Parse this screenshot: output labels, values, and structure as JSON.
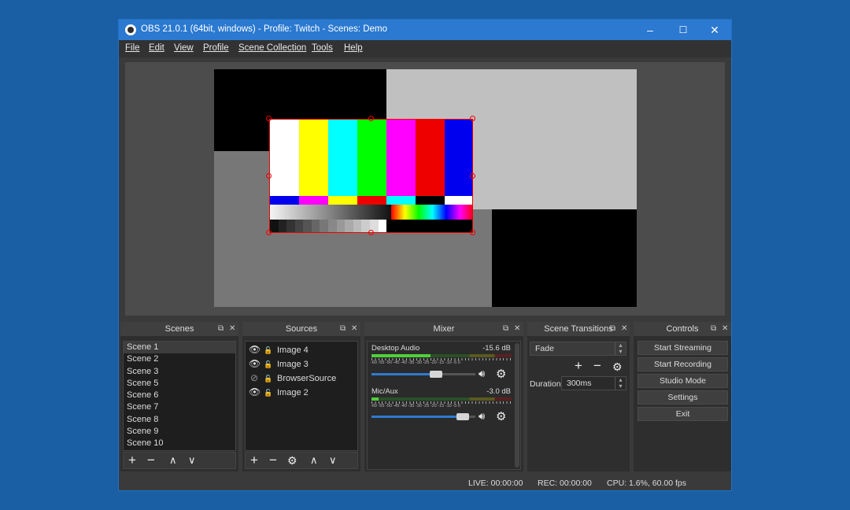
{
  "window": {
    "title": "OBS 21.0.1 (64bit, windows) - Profile: Twitch - Scenes: Demo",
    "controls": {
      "minimize": "–",
      "maximize": "☐",
      "close": "✕"
    }
  },
  "menu": [
    "File",
    "Edit",
    "View",
    "Profile",
    "Scene Collection",
    "Tools",
    "Help"
  ],
  "docks": {
    "scenes": {
      "title": "Scenes",
      "items": [
        "Scene 1",
        "Scene 2",
        "Scene 3",
        "Scene 5",
        "Scene 6",
        "Scene 7",
        "Scene 8",
        "Scene 9",
        "Scene 10"
      ],
      "selected": "Scene 1"
    },
    "sources": {
      "title": "Sources",
      "items": [
        {
          "name": "Image 4",
          "icon": "eye-icon"
        },
        {
          "name": "Image 3",
          "icon": "eye-icon"
        },
        {
          "name": "BrowserSource",
          "icon": "eye-hidden-icon"
        },
        {
          "name": "Image 2",
          "icon": "eye-icon"
        }
      ]
    },
    "mixer": {
      "title": "Mixer",
      "channels": [
        {
          "name": "Desktop Audio",
          "db": "-15.6 dB",
          "level": 0.42,
          "volume": 0.62
        },
        {
          "name": "Mic/Aux",
          "db": "-3.0 dB",
          "level": 0.05,
          "volume": 0.88
        }
      ],
      "ticks": "-60 -55 -50 -45 -40 -35 -30 -25 -20 -15 -10 -5 0"
    },
    "transitions": {
      "title": "Scene Transitions",
      "transition": "Fade",
      "duration_label": "Duration",
      "duration": "300ms"
    },
    "controls": {
      "title": "Controls",
      "buttons": [
        "Start Streaming",
        "Start Recording",
        "Studio Mode",
        "Settings",
        "Exit"
      ]
    }
  },
  "status": {
    "live": "LIVE: 00:00:00",
    "rec": "REC: 00:00:00",
    "cpu": "CPU: 1.6%, 60.00 fps"
  },
  "colors": {
    "titlebar": "#2b79d0",
    "desktop": "#1a5fa3",
    "selection_border": "#e00000",
    "slider": "#2f7ad1"
  }
}
